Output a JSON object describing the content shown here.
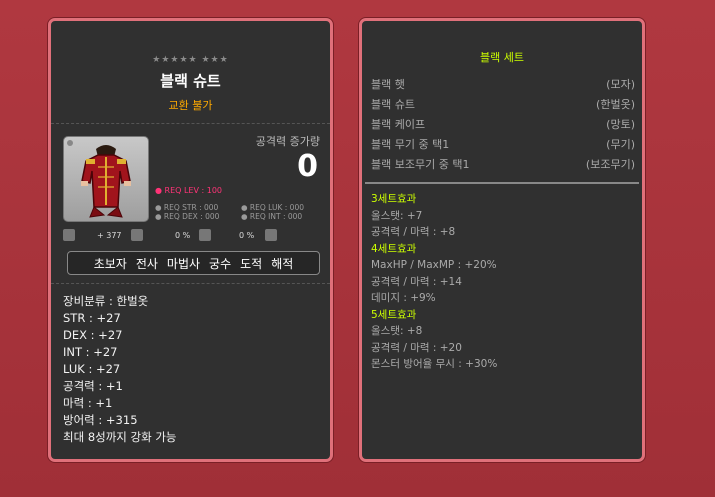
{
  "item": {
    "stars": "★★★★★ ★★★",
    "name": "블랙 슈트",
    "trade": "교환 불가",
    "attack_label": "공격력 증가량",
    "attack_value": "0",
    "req_lev": "● REQ LEV : 100",
    "req_str": "● REQ STR : 000",
    "req_luk": "● REQ LUK : 000",
    "req_dex": "● REQ DEX : 000",
    "req_int": "● REQ INT : 000",
    "misc_1": "+ 377",
    "misc_2": "0 %",
    "misc_3": "0 %",
    "jobs": [
      "초보자",
      "전사",
      "마법사",
      "궁수",
      "도적",
      "해적"
    ],
    "stats": [
      "장비분류 : 한벌옷",
      "STR : +27",
      "DEX : +27",
      "INT : +27",
      "LUK : +27",
      "공격력 : +1",
      "마력 : +1",
      "방어력 : +315",
      "최대 8성까지 강화 가능"
    ]
  },
  "set": {
    "title": "블랙 세트",
    "items": [
      {
        "name": "블랙 햇",
        "type": "(모자)"
      },
      {
        "name": "블랙 슈트",
        "type": "(한벌옷)"
      },
      {
        "name": "블랙 케이프",
        "type": "(망토)"
      },
      {
        "name": "블랙 무기 중 택1",
        "type": "(무기)"
      },
      {
        "name": "블랙 보조무기 중 택1",
        "type": "(보조무기)"
      }
    ],
    "effects": [
      {
        "head": "3세트효과",
        "lines": [
          "올스탯: +7",
          "공격력 / 마력 : +8"
        ]
      },
      {
        "head": "4세트효과",
        "lines": [
          "MaxHP / MaxMP : +20%",
          "공격력 / 마력 : +14",
          "데미지 : +9%"
        ]
      },
      {
        "head": "5세트효과",
        "lines": [
          "올스탯: +8",
          "공격력 / 마력 : +20",
          "몬스터 방어율 무시 : +30%"
        ]
      }
    ]
  },
  "colors": {
    "background": "#a8343c",
    "panel": "#303030",
    "panel_border": "#e0707a",
    "set_header": "#ccff00",
    "trade": "#ffaa00",
    "req_lev": "#ff3377"
  }
}
